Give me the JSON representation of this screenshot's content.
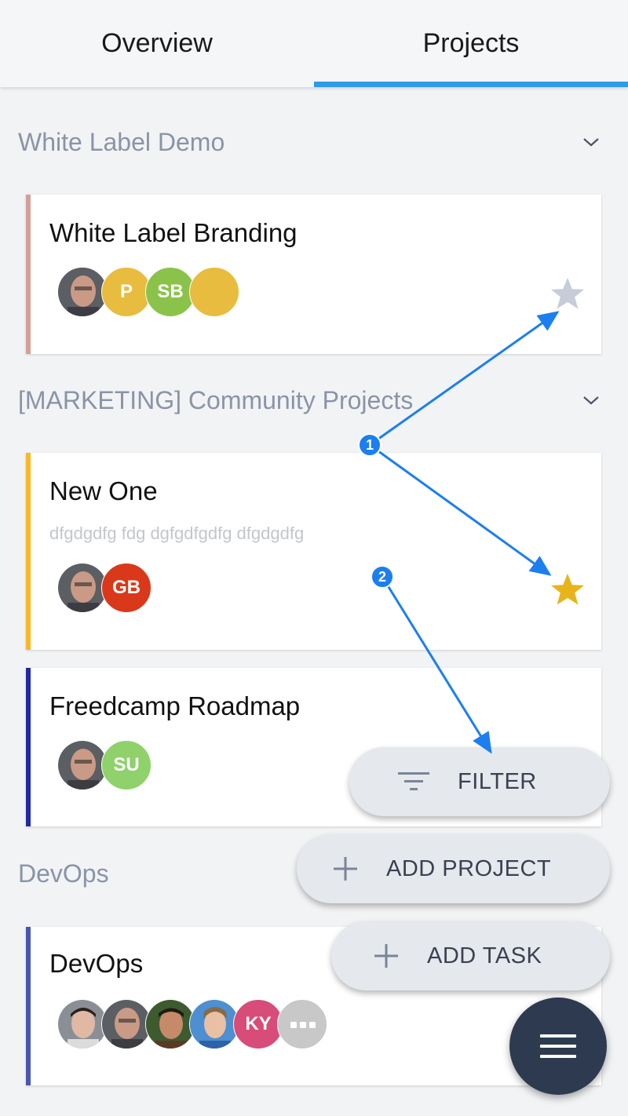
{
  "tabs": [
    {
      "label": "Overview",
      "active": false
    },
    {
      "label": "Projects",
      "active": true
    }
  ],
  "colors": {
    "accent": "#2b9bea",
    "fab": "#2d3a4f",
    "star_active": "#e8b41b",
    "star_inactive": "#c6ccd8",
    "annotation": "#1b7ff0"
  },
  "groups": [
    {
      "title": "White Label Demo",
      "projects": [
        {
          "title": "White Label Branding",
          "description": "",
          "bar_color": "#d59f99",
          "starred": false,
          "members": [
            {
              "kind": "photo"
            },
            {
              "initials": "P",
              "color": "#e8bc3e"
            },
            {
              "initials": "SB",
              "color": "#8bc34a"
            },
            {
              "initials": "",
              "color": "#e8bc3e"
            }
          ]
        }
      ]
    },
    {
      "title": "[MARKETING] Community Projects",
      "projects": [
        {
          "title": "New One",
          "description": "dfgdgdfg fdg dgfgdfgdfg dfgdgdfg",
          "bar_color": "#f9b825",
          "starred": true,
          "members": [
            {
              "kind": "photo"
            },
            {
              "initials": "GB",
              "color": "#d9391a"
            }
          ]
        },
        {
          "title": "Freedcamp Roadmap",
          "description": "",
          "bar_color": "#2029a6",
          "members": [
            {
              "kind": "photo"
            },
            {
              "initials": "SU",
              "color": "#8fd16a"
            }
          ]
        }
      ]
    },
    {
      "title": "DevOps",
      "projects": [
        {
          "title": "DevOps",
          "description": "",
          "bar_color": "#4856b5",
          "members": [
            {
              "kind": "photo"
            },
            {
              "kind": "photo"
            },
            {
              "kind": "photo"
            },
            {
              "kind": "photo"
            },
            {
              "initials": "KY",
              "color": "#d84c79"
            },
            {
              "initials": "",
              "color": "#c8c8c8",
              "more": true
            }
          ]
        }
      ]
    }
  ],
  "actions": {
    "filter": "FILTER",
    "add_project": "ADD PROJECT",
    "add_task": "ADD TASK"
  },
  "icons": {
    "filter": "filter-icon",
    "add": "plus-icon",
    "menu": "hamburger-menu-icon",
    "star": "star-icon",
    "collapse": "chevron-down-icon"
  },
  "annotations": [
    {
      "label": "1"
    },
    {
      "label": "2"
    }
  ]
}
